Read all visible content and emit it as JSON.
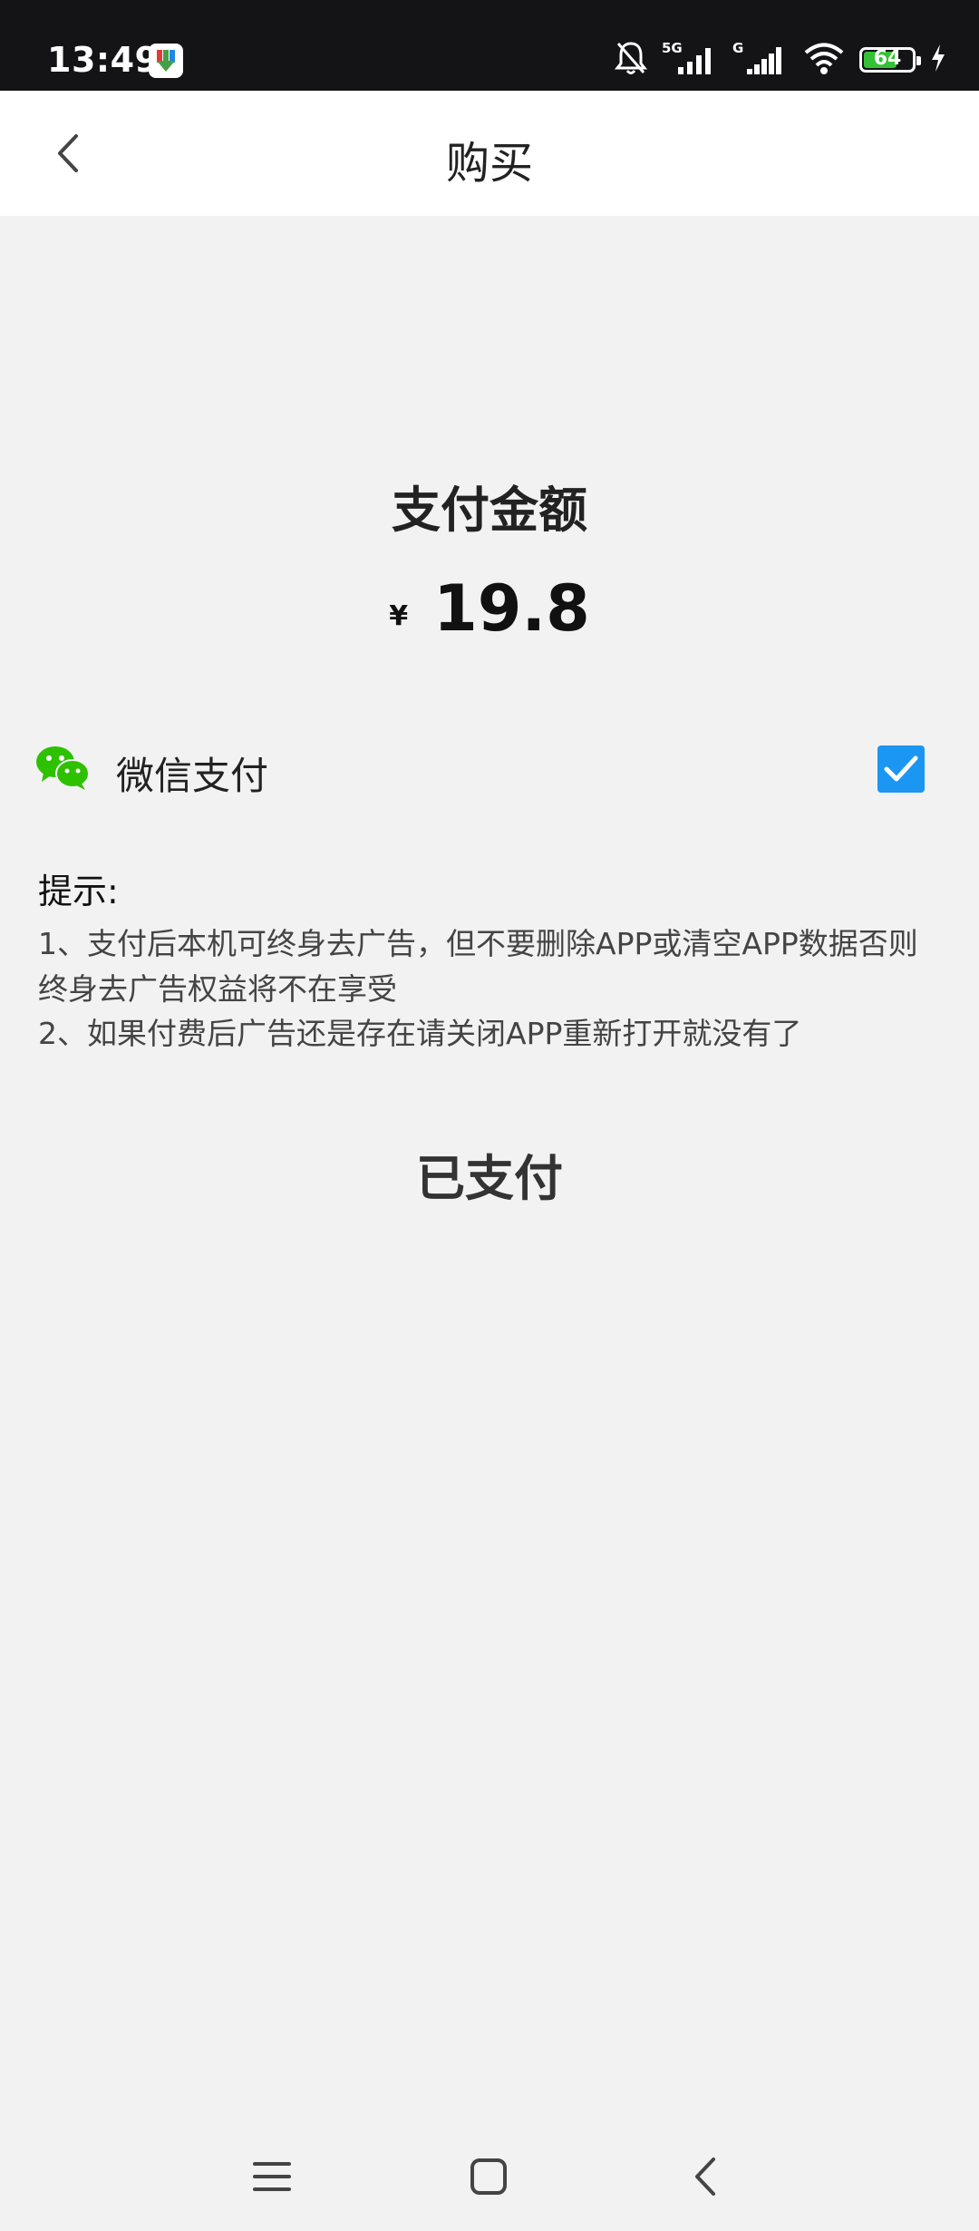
{
  "status_bar": {
    "time": "13:49",
    "network_5g": "5G",
    "network_g": "G",
    "battery_level": "64"
  },
  "header": {
    "title": "购买"
  },
  "payment": {
    "amount_label": "支付金额",
    "currency_symbol": "¥",
    "amount": "19.8",
    "method_label": "微信支付",
    "method_selected": true
  },
  "tips": {
    "title": "提示:",
    "items": [
      "1、支付后本机可终身去广告，但不要删除APP或清空APP数据否则终身去广告权益将不在享受",
      "2、如果付费后广告还是存在请关闭APP重新打开就没有了"
    ]
  },
  "actions": {
    "paid_label": "已支付"
  },
  "colors": {
    "status_bar_bg": "#141417",
    "page_bg": "#f2f2f3",
    "checkbox_blue": "#1b96f3",
    "wechat_green": "#2dc100",
    "battery_green": "#35c136"
  }
}
